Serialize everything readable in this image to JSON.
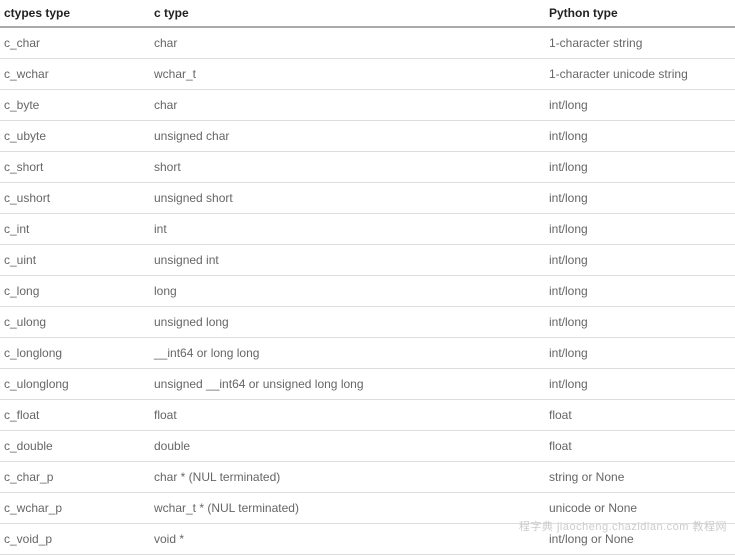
{
  "table": {
    "headers": {
      "col1": "ctypes type",
      "col2": "c type",
      "col3": "Python type"
    },
    "rows": [
      {
        "col1": "c_char",
        "col2": "char",
        "col3": "1-character string"
      },
      {
        "col1": "c_wchar",
        "col2": "wchar_t",
        "col3": "1-character unicode string"
      },
      {
        "col1": "c_byte",
        "col2": "char",
        "col3": "int/long"
      },
      {
        "col1": "c_ubyte",
        "col2": "unsigned char",
        "col3": "int/long"
      },
      {
        "col1": "c_short",
        "col2": "short",
        "col3": "int/long"
      },
      {
        "col1": "c_ushort",
        "col2": "unsigned short",
        "col3": "int/long"
      },
      {
        "col1": "c_int",
        "col2": "int",
        "col3": "int/long"
      },
      {
        "col1": "c_uint",
        "col2": "unsigned int",
        "col3": "int/long"
      },
      {
        "col1": "c_long",
        "col2": "long",
        "col3": "int/long"
      },
      {
        "col1": "c_ulong",
        "col2": "unsigned long",
        "col3": "int/long"
      },
      {
        "col1": "c_longlong",
        "col2": "__int64 or long long",
        "col3": "int/long"
      },
      {
        "col1": "c_ulonglong",
        "col2": "unsigned __int64 or unsigned long long",
        "col3": "int/long"
      },
      {
        "col1": "c_float",
        "col2": "float",
        "col3": "float"
      },
      {
        "col1": "c_double",
        "col2": "double",
        "col3": "float"
      },
      {
        "col1": "c_char_p",
        "col2": "char * (NUL terminated)",
        "col3": "string or None"
      },
      {
        "col1": "c_wchar_p",
        "col2": "wchar_t * (NUL terminated)",
        "col3": "unicode or None"
      },
      {
        "col1": "c_void_p",
        "col2": "void *",
        "col3": "int/long or None"
      }
    ]
  },
  "watermark": "程字典 jiaocheng.chazidian.com 教程网"
}
